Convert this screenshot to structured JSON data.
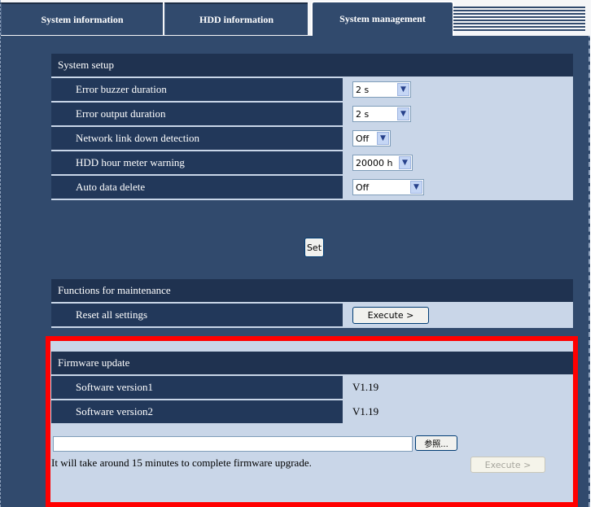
{
  "tabs": [
    {
      "label": "System information"
    },
    {
      "label": "HDD information"
    },
    {
      "label": "System management"
    }
  ],
  "system_setup": {
    "header": "System setup",
    "rows": [
      {
        "label": "Error buzzer duration",
        "value": "2 s"
      },
      {
        "label": "Error output duration",
        "value": "2 s"
      },
      {
        "label": "Network link down detection",
        "value": "Off"
      },
      {
        "label": "HDD hour meter warning",
        "value": "20000 h"
      },
      {
        "label": "Auto data delete",
        "value": "Off"
      }
    ],
    "set_label": "Set"
  },
  "maintenance": {
    "header": "Functions for maintenance",
    "reset_label": "Reset all settings",
    "execute_label": "Execute >"
  },
  "firmware": {
    "header": "Firmware update",
    "rows": [
      {
        "label": "Software version1",
        "value": "V1.19"
      },
      {
        "label": "Software version2",
        "value": "V1.19"
      }
    ],
    "file_value": "",
    "browse_label": "参照...",
    "note": "It will take around 15 minutes to complete firmware upgrade.",
    "execute_label": "Execute >"
  },
  "colors": {
    "highlight": "#ff0000",
    "panel_bg": "#314a6d",
    "row_value_bg": "#c9d6e8"
  }
}
